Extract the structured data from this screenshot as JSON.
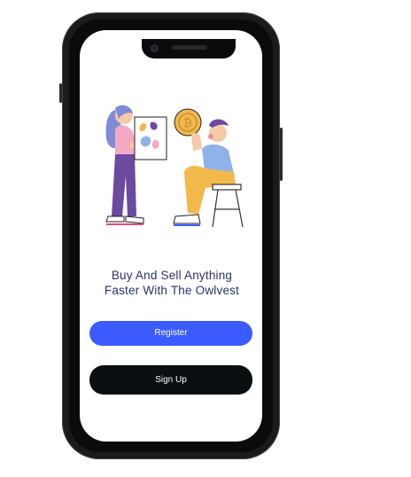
{
  "onboarding": {
    "headline_line1": "Buy And Sell Anything",
    "headline_line2": "Faster With The Owlvest",
    "register_label": "Register",
    "signup_label": "Sign Up",
    "illustration_icon": "bitcoin-coin-illustration"
  },
  "colors": {
    "accent": "#3c5bff",
    "dark": "#0a0f12",
    "headline": "#26346b",
    "coin": "#f2b84b"
  }
}
